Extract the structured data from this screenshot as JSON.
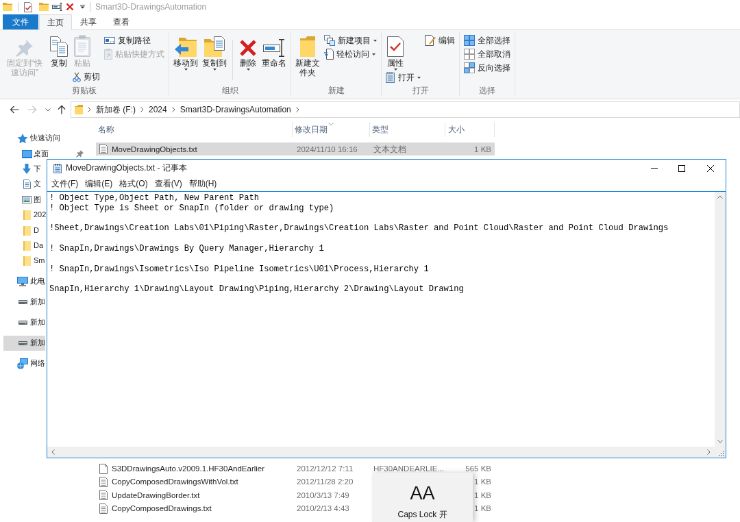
{
  "window": {
    "title": "Smart3D-DrawingsAutomation"
  },
  "ribbon": {
    "tabs": [
      {
        "label": "文件",
        "kind": "menu",
        "selected": false
      },
      {
        "label": "主页",
        "kind": "tab",
        "selected": true
      },
      {
        "label": "共享",
        "kind": "tab",
        "selected": false
      },
      {
        "label": "查看",
        "kind": "tab",
        "selected": false
      }
    ],
    "groups": [
      {
        "label": "剪贴板",
        "columns": [
          {
            "kind": "stack",
            "items": [
              {
                "label": "固定到“快速访问”",
                "kind": "large",
                "disabled": true,
                "dropdown": false
              }
            ]
          },
          {
            "kind": "stack",
            "items": [
              {
                "label": "复制",
                "kind": "large",
                "disabled": false,
                "dropdown": false
              }
            ]
          },
          {
            "kind": "stack",
            "items": [
              {
                "label": "粘贴",
                "kind": "large",
                "disabled": true,
                "dropdown": false
              },
              {
                "label": "剪切",
                "kind": "small",
                "disabled": false,
                "dropdown": false
              }
            ]
          },
          {
            "kind": "stack",
            "items": [
              {
                "label": "复制路径",
                "kind": "small",
                "disabled": false,
                "dropdown": false
              },
              {
                "label": "粘贴快捷方式",
                "kind": "small",
                "disabled": true,
                "dropdown": false
              }
            ]
          }
        ]
      },
      {
        "label": "组织",
        "columns": [
          {
            "kind": "stack",
            "items": [
              {
                "label": "移动到",
                "kind": "large",
                "disabled": false,
                "dropdown": true
              }
            ]
          },
          {
            "kind": "stack",
            "items": [
              {
                "label": "复制到",
                "kind": "large",
                "disabled": false,
                "dropdown": true
              }
            ]
          },
          {
            "kind": "separator"
          },
          {
            "kind": "stack",
            "items": [
              {
                "label": "删除",
                "kind": "large",
                "disabled": false,
                "dropdown": true
              }
            ]
          },
          {
            "kind": "stack",
            "items": [
              {
                "label": "重命名",
                "kind": "large",
                "disabled": false,
                "dropdown": false
              }
            ]
          }
        ]
      },
      {
        "label": "新建",
        "columns": [
          {
            "kind": "stack",
            "items": [
              {
                "label": "新建文件夹",
                "kind": "large",
                "disabled": false,
                "dropdown": false
              }
            ]
          },
          {
            "kind": "stack",
            "items": [
              {
                "label": "新建项目",
                "kind": "small",
                "disabled": false,
                "dropdown": true
              },
              {
                "label": "轻松访问",
                "kind": "small",
                "disabled": false,
                "dropdown": true
              }
            ]
          }
        ]
      },
      {
        "label": "打开",
        "columns": [
          {
            "kind": "stack",
            "items": [
              {
                "label": "属性",
                "kind": "large",
                "disabled": false,
                "dropdown": true
              },
              {
                "label": "打开",
                "kind": "small",
                "disabled": false,
                "dropdown": true
              }
            ]
          },
          {
            "kind": "stack",
            "items": [
              {
                "label": "编辑",
                "kind": "small",
                "disabled": false,
                "dropdown": false
              }
            ]
          }
        ]
      },
      {
        "label": "选择",
        "columns": [
          {
            "kind": "stack",
            "items": [
              {
                "label": "全部选择",
                "kind": "small",
                "disabled": false,
                "dropdown": false
              },
              {
                "label": "全部取消",
                "kind": "small",
                "disabled": false,
                "dropdown": false
              },
              {
                "label": "反向选择",
                "kind": "small",
                "disabled": false,
                "dropdown": false
              }
            ]
          }
        ]
      }
    ]
  },
  "address": {
    "navigation": [
      {
        "kind": "back",
        "disabled": false
      },
      {
        "kind": "forward",
        "disabled": true
      },
      {
        "kind": "recent",
        "disabled": false
      },
      {
        "kind": "up",
        "disabled": false
      }
    ],
    "segments": [
      "新加卷 (F:)",
      "2024",
      "Smart3D-DrawingsAutomation"
    ]
  },
  "navigation_pane": {
    "items": [
      {
        "label": "快速访问",
        "kind": "quick-access",
        "selected": false,
        "children": [
          {
            "label": "桌面",
            "kind": "desktop",
            "selected": false,
            "pinned": true
          },
          {
            "label": "下",
            "kind": "downloads",
            "selected": false
          },
          {
            "label": "文",
            "kind": "documents",
            "selected": false
          },
          {
            "label": "图",
            "kind": "pictures",
            "selected": false
          },
          {
            "label": "202",
            "kind": "folder",
            "selected": false
          },
          {
            "label": "D",
            "kind": "folder",
            "selected": false
          },
          {
            "label": "Da",
            "kind": "folder",
            "selected": false
          },
          {
            "label": "Sm",
            "kind": "folder",
            "selected": false
          }
        ]
      },
      {
        "label": "此电",
        "kind": "this-pc",
        "selected": false
      },
      {
        "label": "新加",
        "kind": "drive",
        "selected": false
      },
      {
        "label": "新加",
        "kind": "drive",
        "selected": false
      },
      {
        "label": "新加",
        "kind": "drive",
        "selected": true
      },
      {
        "label": "网络",
        "kind": "network",
        "selected": false
      }
    ]
  },
  "file_list": {
    "columns": [
      {
        "label": "名称",
        "sorted": false
      },
      {
        "label": "修改日期",
        "sorted": true
      },
      {
        "label": "类型",
        "sorted": false
      },
      {
        "label": "大小",
        "sorted": false
      }
    ],
    "rows_above": [
      {
        "name": "MoveDrawingObjects.txt",
        "modified": "2024/11/10 16:16",
        "type": "文本文档",
        "size": "1 KB",
        "kind": "text",
        "selected": true
      }
    ],
    "rows_below": [
      {
        "name": "S3DDrawingsAuto.v2009.1.HF30AndEarlier",
        "modified": "2012/12/12 7:11",
        "type": "HF30ANDEARLIE...",
        "size": "565 KB",
        "kind": "file",
        "selected": false
      },
      {
        "name": "CopyComposedDrawingsWithVol.txt",
        "modified": "2012/11/28 2:20",
        "size": "1 KB",
        "kind": "text",
        "selected": false
      },
      {
        "name": "UpdateDrawingBorder.txt",
        "modified": "2010/3/13 7:49",
        "size": "1 KB",
        "kind": "text",
        "selected": false
      },
      {
        "name": "CopyComposedDrawings.txt",
        "modified": "2010/2/13 4:43",
        "size": "1 KB",
        "kind": "text",
        "selected": false
      }
    ]
  },
  "notepad": {
    "title": "MoveDrawingObjects.txt - 记事本",
    "menu": [
      "文件(F)",
      "编辑(E)",
      "格式(O)",
      "查看(V)",
      "帮助(H)"
    ],
    "text": "! Object Type,Object Path, New Parent Path\n! Object Type is Sheet or SnapIn (folder or drawing type)\n\n!Sheet,Drawings\\Creation Labs\\01\\Piping\\Raster,Drawings\\Creation Labs\\Raster and Point Cloud\\Raster and Point Cloud Drawings\n\n! SnapIn,Drawings\\Drawings By Query Manager,Hierarchy 1\n\n! SnapIn,Drawings\\Isometrics\\Iso Pipeline Isometrics\\U01\\Process,Hierarchy 1\n\nSnapIn,Hierarchy 1\\Drawing\\Layout Drawing\\Piping,Hierarchy 2\\Drawing\\Layout Drawing"
  },
  "caps_lock_indicator": {
    "symbol": "AA",
    "label": "Caps Lock 开"
  }
}
